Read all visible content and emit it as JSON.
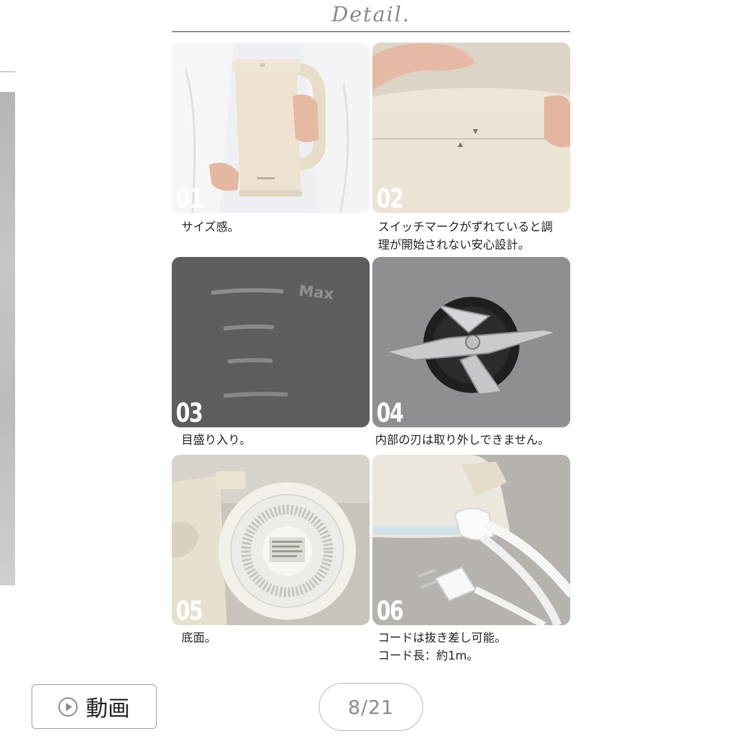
{
  "header": {
    "title": "Detail."
  },
  "details": [
    {
      "number": "01",
      "caption_lines": [
        "サイズ感。"
      ],
      "icon": "kettle-held-image"
    },
    {
      "number": "02",
      "caption_lines": [
        "スイッチマークがずれていると調",
        "理が開始されない安心設計。"
      ],
      "icon": "lid-switch-mark-image"
    },
    {
      "number": "03",
      "caption_lines": [
        "目盛り入り。"
      ],
      "icon": "scale-marks-image"
    },
    {
      "number": "04",
      "caption_lines": [
        "内部の刃は取り外しできません。"
      ],
      "icon": "blade-image"
    },
    {
      "number": "05",
      "caption_lines": [
        "底面。"
      ],
      "icon": "bottom-view-image"
    },
    {
      "number": "06",
      "caption_lines": [
        "コードは抜き差し可能。",
        "コード長：約1m。"
      ],
      "icon": "power-cord-image"
    }
  ],
  "image_text": {
    "max_label": "Max"
  },
  "footer": {
    "video_label": "動画",
    "pager": "8/21"
  },
  "colors": {
    "kettle": "#ede4d2",
    "dark_panel": "#5c5e5e",
    "text": "#222222",
    "muted": "#8a8a8a"
  }
}
